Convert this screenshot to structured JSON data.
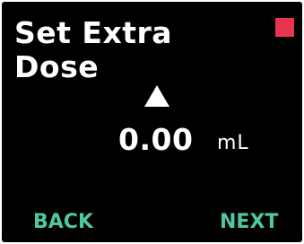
{
  "screen": {
    "title_line1": "Set Extra",
    "title_line2": "Dose",
    "status_color": "#e8344f",
    "increase_icon": "up-triangle-icon"
  },
  "dose": {
    "value": "0.00",
    "unit": "mL"
  },
  "softkeys": {
    "back_label": "BACK",
    "next_label": "NEXT"
  },
  "colors": {
    "background": "#000000",
    "text": "#ffffff",
    "softkey": "#4fc7a4",
    "status": "#e8344f"
  }
}
